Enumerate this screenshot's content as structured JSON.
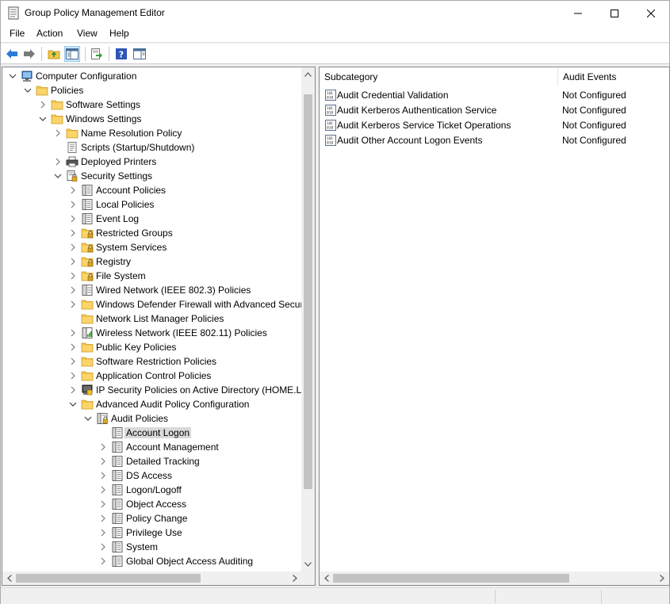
{
  "window": {
    "title": "Group Policy Management Editor",
    "minimize_icon": "minimize-icon",
    "maximize_icon": "maximize-icon",
    "close_icon": "close-icon"
  },
  "menu": [
    "File",
    "Action",
    "View",
    "Help"
  ],
  "toolbar": {
    "buttons": [
      "back-icon",
      "forward-icon",
      "up-folder-icon",
      "show-hide-tree-icon",
      "export-list-icon",
      "help-icon",
      "properties-pane-icon"
    ],
    "active": "show-hide-tree-icon"
  },
  "tree": [
    {
      "label": "Computer Configuration",
      "level": 0,
      "expand": "expanded",
      "icon": "computer-icon"
    },
    {
      "label": "Policies",
      "level": 1,
      "expand": "expanded",
      "icon": "folder-icon"
    },
    {
      "label": "Software Settings",
      "level": 2,
      "expand": "collapsed",
      "icon": "folder-icon"
    },
    {
      "label": "Windows Settings",
      "level": 2,
      "expand": "expanded",
      "icon": "folder-icon"
    },
    {
      "label": "Name Resolution Policy",
      "level": 3,
      "expand": "collapsed",
      "icon": "folder-icon"
    },
    {
      "label": "Scripts (Startup/Shutdown)",
      "level": 3,
      "expand": "none",
      "icon": "script-icon"
    },
    {
      "label": "Deployed Printers",
      "level": 3,
      "expand": "collapsed",
      "icon": "printer-icon"
    },
    {
      "label": "Security Settings",
      "level": 3,
      "expand": "expanded",
      "icon": "security-settings-icon"
    },
    {
      "label": "Account Policies",
      "level": 4,
      "expand": "collapsed",
      "icon": "policy-book-icon"
    },
    {
      "label": "Local Policies",
      "level": 4,
      "expand": "collapsed",
      "icon": "policy-book-icon"
    },
    {
      "label": "Event Log",
      "level": 4,
      "expand": "collapsed",
      "icon": "policy-book-icon"
    },
    {
      "label": "Restricted Groups",
      "level": 4,
      "expand": "collapsed",
      "icon": "locked-folder-icon"
    },
    {
      "label": "System Services",
      "level": 4,
      "expand": "collapsed",
      "icon": "locked-folder-icon"
    },
    {
      "label": "Registry",
      "level": 4,
      "expand": "collapsed",
      "icon": "locked-folder-icon"
    },
    {
      "label": "File System",
      "level": 4,
      "expand": "collapsed",
      "icon": "locked-folder-icon"
    },
    {
      "label": "Wired Network (IEEE 802.3) Policies",
      "level": 4,
      "expand": "collapsed",
      "icon": "wired-network-icon"
    },
    {
      "label": "Windows Defender Firewall with Advanced Secur",
      "level": 4,
      "expand": "collapsed",
      "icon": "folder-icon"
    },
    {
      "label": "Network List Manager Policies",
      "level": 4,
      "expand": "none",
      "icon": "folder-icon"
    },
    {
      "label": "Wireless Network (IEEE 802.11) Policies",
      "level": 4,
      "expand": "collapsed",
      "icon": "wireless-network-icon"
    },
    {
      "label": "Public Key Policies",
      "level": 4,
      "expand": "collapsed",
      "icon": "folder-icon"
    },
    {
      "label": "Software Restriction Policies",
      "level": 4,
      "expand": "collapsed",
      "icon": "folder-icon"
    },
    {
      "label": "Application Control Policies",
      "level": 4,
      "expand": "collapsed",
      "icon": "folder-icon"
    },
    {
      "label": "IP Security Policies on Active Directory (HOME.LO",
      "level": 4,
      "expand": "collapsed",
      "icon": "ip-security-icon"
    },
    {
      "label": "Advanced Audit Policy Configuration",
      "level": 4,
      "expand": "expanded",
      "icon": "folder-icon"
    },
    {
      "label": "Audit Policies",
      "level": 5,
      "expand": "expanded",
      "icon": "audit-policies-icon"
    },
    {
      "label": "Account Logon",
      "level": 6,
      "expand": "none",
      "icon": "policy-book-icon",
      "selected": true
    },
    {
      "label": "Account Management",
      "level": 6,
      "expand": "collapsed",
      "icon": "policy-book-icon"
    },
    {
      "label": "Detailed Tracking",
      "level": 6,
      "expand": "collapsed",
      "icon": "policy-book-icon"
    },
    {
      "label": "DS Access",
      "level": 6,
      "expand": "collapsed",
      "icon": "policy-book-icon"
    },
    {
      "label": "Logon/Logoff",
      "level": 6,
      "expand": "collapsed",
      "icon": "policy-book-icon"
    },
    {
      "label": "Object Access",
      "level": 6,
      "expand": "collapsed",
      "icon": "policy-book-icon"
    },
    {
      "label": "Policy Change",
      "level": 6,
      "expand": "collapsed",
      "icon": "policy-book-icon"
    },
    {
      "label": "Privilege Use",
      "level": 6,
      "expand": "collapsed",
      "icon": "policy-book-icon"
    },
    {
      "label": "System",
      "level": 6,
      "expand": "collapsed",
      "icon": "policy-book-icon"
    },
    {
      "label": "Global Object Access Auditing",
      "level": 6,
      "expand": "collapsed",
      "icon": "policy-book-icon"
    }
  ],
  "list": {
    "columns": [
      "Subcategory",
      "Audit Events"
    ],
    "rows": [
      {
        "name": "Audit Credential Validation",
        "value": "Not Configured",
        "icon": "audit-setting-icon"
      },
      {
        "name": "Audit Kerberos Authentication Service",
        "value": "Not Configured",
        "icon": "audit-setting-icon"
      },
      {
        "name": "Audit Kerberos Service Ticket Operations",
        "value": "Not Configured",
        "icon": "audit-setting-icon"
      },
      {
        "name": "Audit Other Account Logon Events",
        "value": "Not Configured",
        "icon": "audit-setting-icon"
      }
    ]
  },
  "colors": {
    "folder": "#f5c64a",
    "selection": "#d9d9d9",
    "toolbar_active": "#cce4f7"
  }
}
